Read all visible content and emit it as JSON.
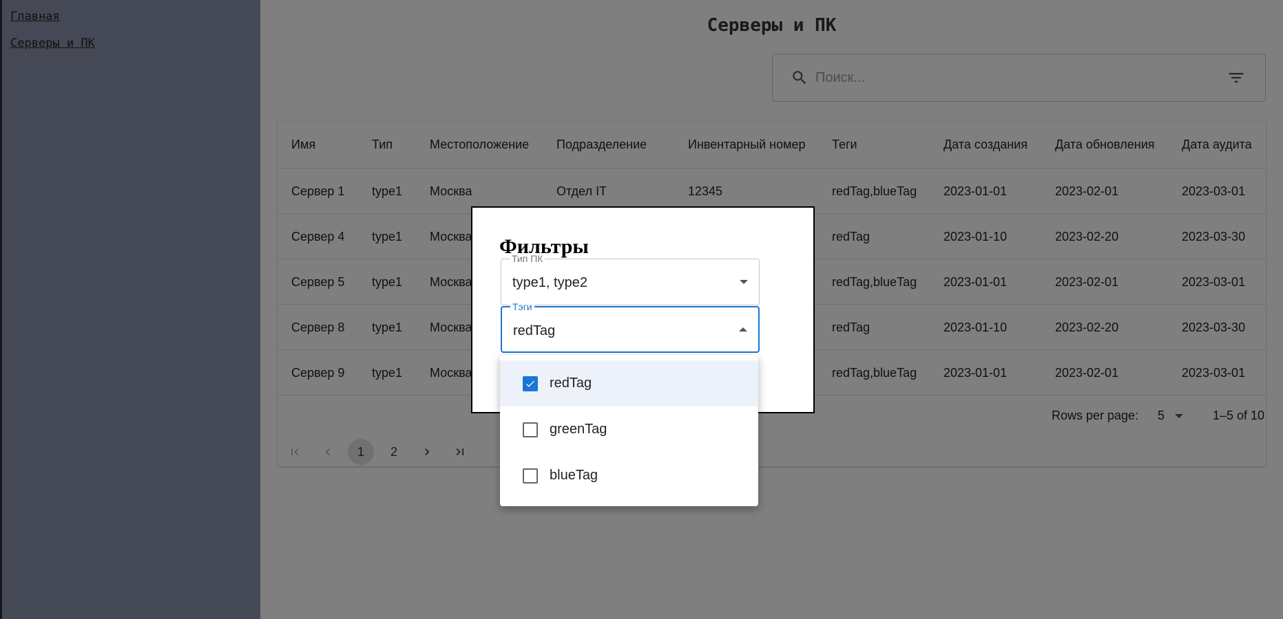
{
  "sidebar": {
    "links": [
      {
        "label": "Главная"
      },
      {
        "label": "Серверы и ПК"
      }
    ]
  },
  "page": {
    "title": "Серверы  и  ПК"
  },
  "search": {
    "placeholder": "Поиск..."
  },
  "table": {
    "columns": [
      "Имя",
      "Тип",
      "Местоположение",
      "Подразделение",
      "Инвентарный номер",
      "Теги",
      "Дата создания",
      "Дата обновления",
      "Дата аудита"
    ],
    "rows": [
      [
        "Сервер 1",
        "type1",
        "Москва",
        "Отдел IT",
        "12345",
        "redTag,blueTag",
        "2023-01-01",
        "2023-02-01",
        "2023-03-01"
      ],
      [
        "Сервер 4",
        "type1",
        "Москва",
        "",
        "",
        "redTag",
        "2023-01-10",
        "2023-02-20",
        "2023-03-30"
      ],
      [
        "Сервер 5",
        "type1",
        "Москва",
        "",
        "",
        "redTag,blueTag",
        "2023-01-01",
        "2023-02-01",
        "2023-03-01"
      ],
      [
        "Сервер 8",
        "type1",
        "Москва",
        "",
        "",
        "redTag",
        "2023-01-10",
        "2023-02-20",
        "2023-03-30"
      ],
      [
        "Сервер 9",
        "type1",
        "Москва",
        "",
        "",
        "redTag,blueTag",
        "2023-01-01",
        "2023-02-01",
        "2023-03-01"
      ]
    ]
  },
  "pagination": {
    "rows_per_page_label": "Rows per page:",
    "rows_per_page_value": "5",
    "range": "1–5 of 10",
    "pages": [
      "1",
      "2"
    ],
    "current_page": "1",
    "icons": [
      "first-page-icon",
      "prev-page-icon",
      "next-page-icon",
      "last-page-icon"
    ]
  },
  "dialog": {
    "title": "Фильтры",
    "pc_type": {
      "label": "Тип ПК",
      "value": "type1, type2"
    },
    "tags": {
      "label": "Тэги",
      "value": "redTag"
    }
  },
  "tag_menu": {
    "options": [
      {
        "label": "redTag",
        "checked": true
      },
      {
        "label": "greenTag",
        "checked": false
      },
      {
        "label": "blueTag",
        "checked": false
      }
    ]
  },
  "colors": {
    "sidebar_bg": "#8a93aa",
    "accent": "#1976d2",
    "backdrop": "rgba(0,0,0,0.5)"
  }
}
